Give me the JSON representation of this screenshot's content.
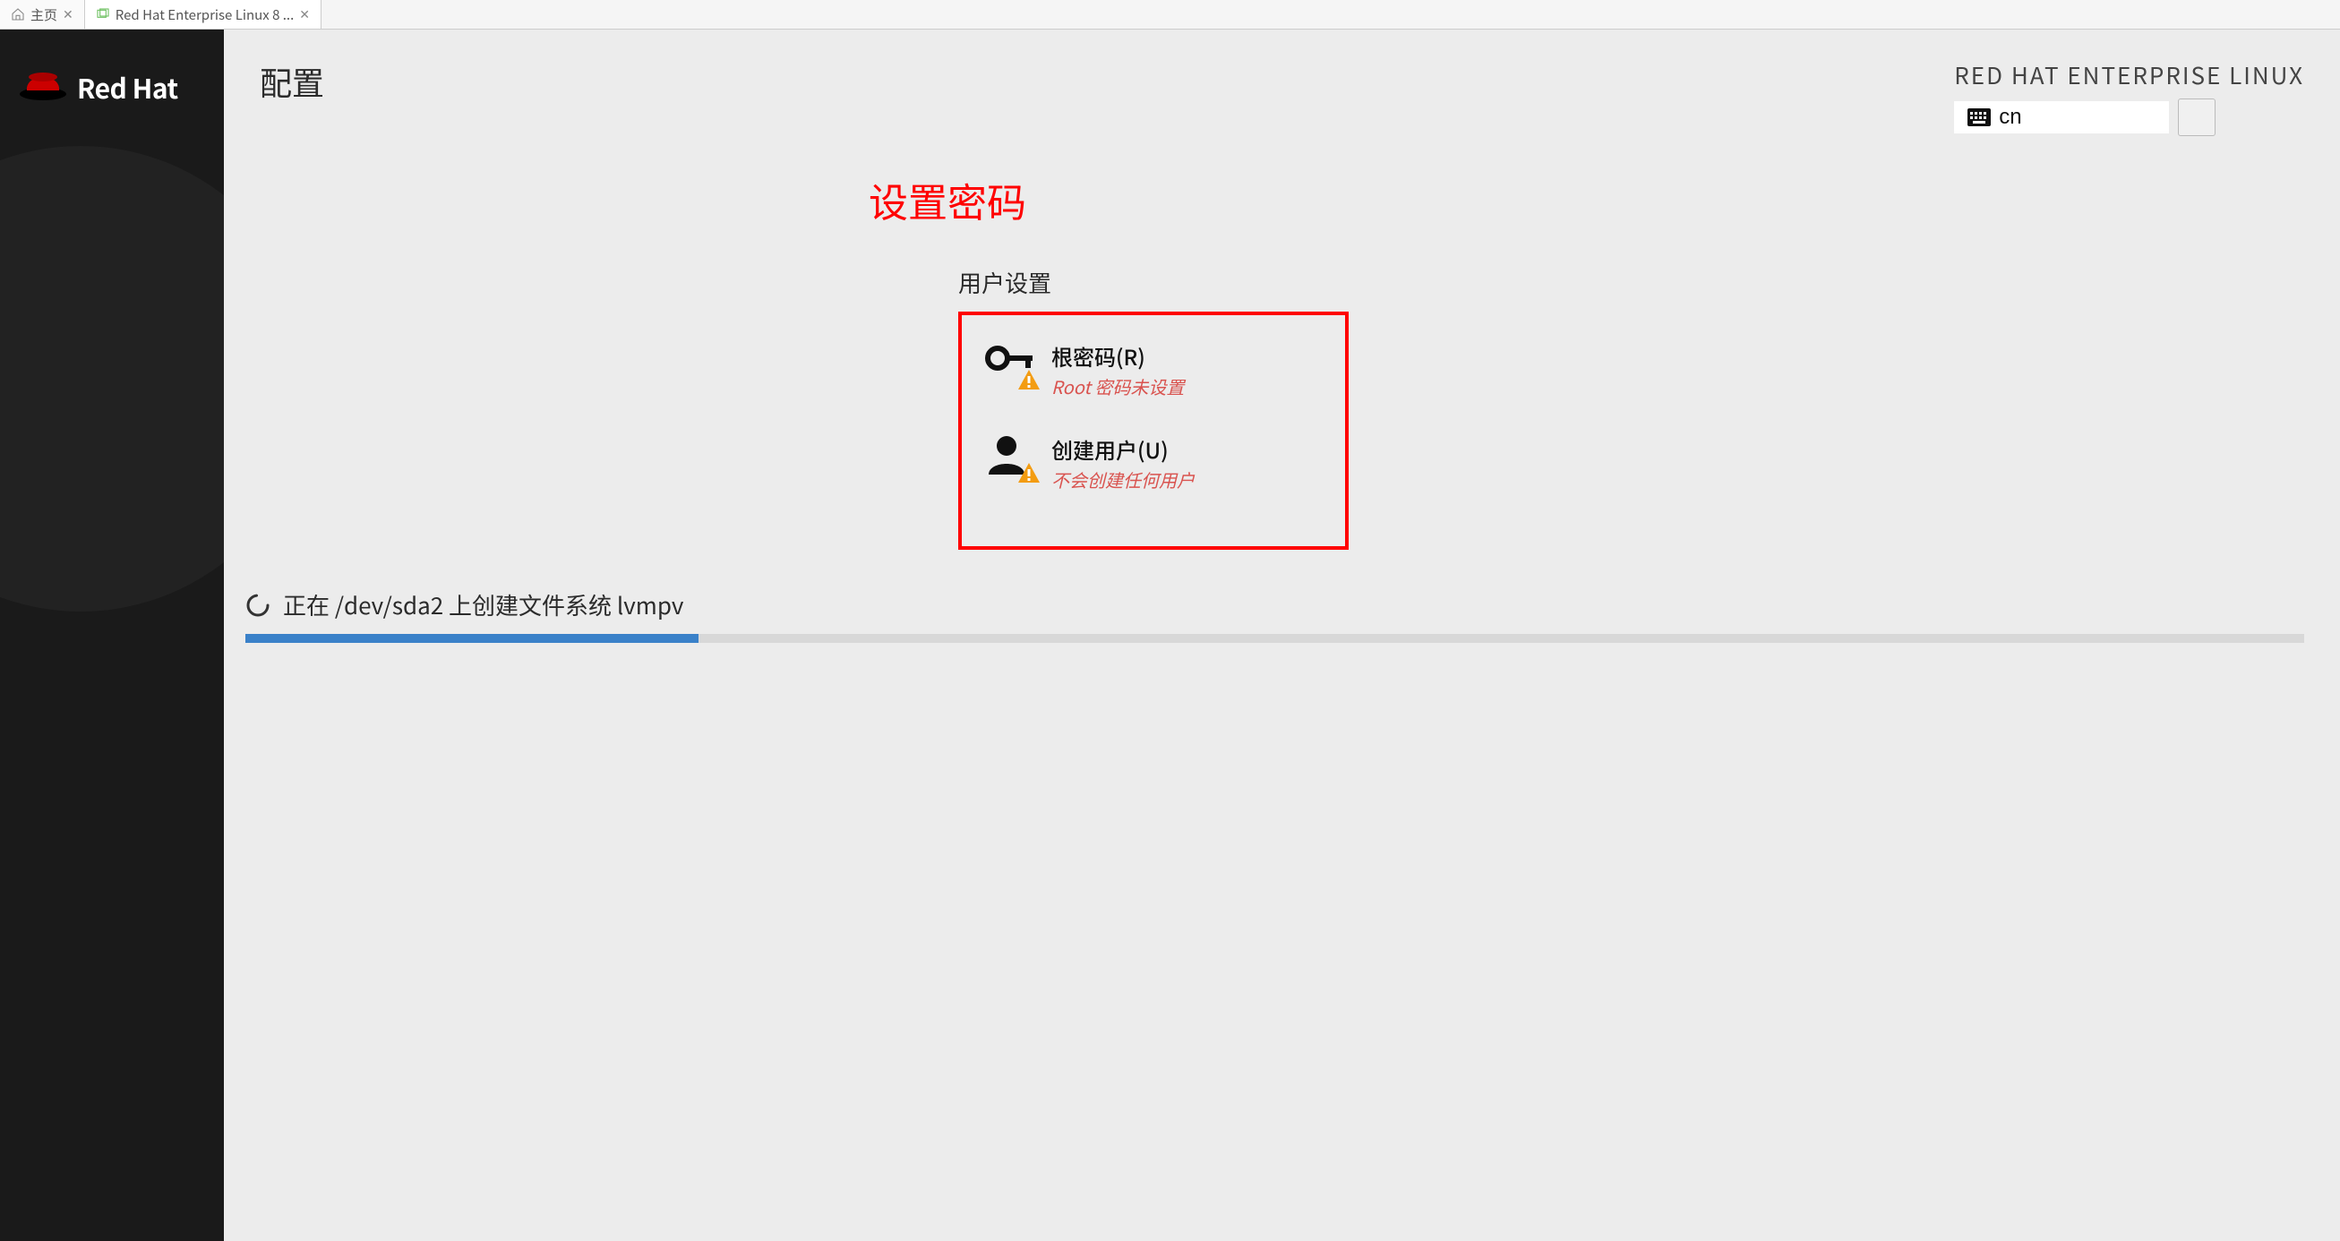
{
  "tabs": {
    "home": "主页",
    "vm": "Red Hat Enterprise Linux 8 ..."
  },
  "sidebar": {
    "brand": "Red Hat"
  },
  "header": {
    "title": "配置",
    "os_name": "RED HAT ENTERPRISE LINUX",
    "lang_label": "cn"
  },
  "annotation": "设置密码",
  "user_settings": {
    "heading": "用户设置",
    "root": {
      "label": "根密码(R)",
      "status": "Root 密码未设置"
    },
    "create_user": {
      "label": "创建用户(U)",
      "status": "不会创建任何用户"
    }
  },
  "progress": {
    "text": "正在 /dev/sda2 上创建文件系统 lvmpv",
    "percent": 22
  }
}
